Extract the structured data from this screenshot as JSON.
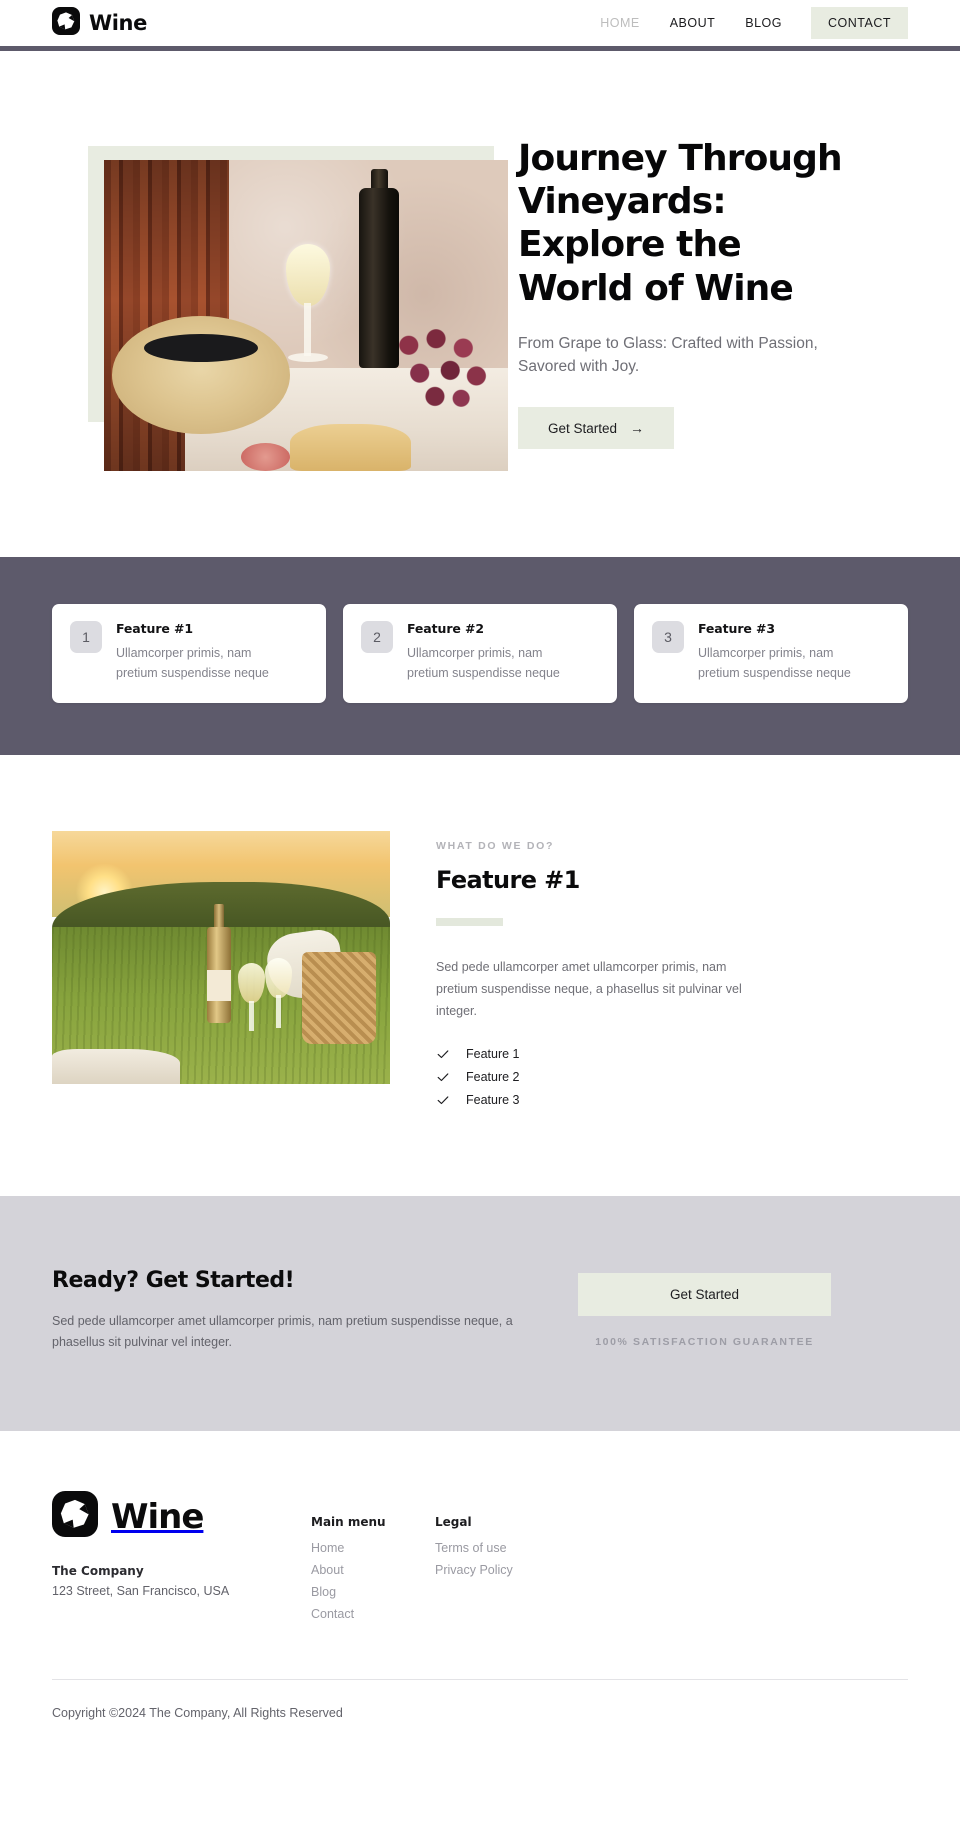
{
  "header": {
    "brand": {
      "name": "Wine",
      "logo_icon": "wine-logo-icon"
    },
    "nav": [
      {
        "label": "HOME",
        "state": "muted"
      },
      {
        "label": "ABOUT",
        "state": "default"
      },
      {
        "label": "BLOG",
        "state": "default"
      }
    ],
    "cta": {
      "label": "CONTACT"
    },
    "accent_color": "#5d5a6b"
  },
  "hero": {
    "image_alt": "wine-bottle-glass-hat-grapes-photo",
    "title": "Journey Through Vineyards: Explore the World of Wine",
    "subtitle": "From Grape to Glass: Crafted with Passion, Savored with Joy.",
    "button": {
      "label": "Get Started",
      "arrow": "→"
    },
    "accent_color": "#e8ece1"
  },
  "feature_strip": {
    "background_color": "#5d5a6b",
    "cards": [
      {
        "number": "1",
        "title": "Feature #1",
        "desc": "Ullamcorper primis, nam pretium suspendisse neque"
      },
      {
        "number": "2",
        "title": "Feature #2",
        "desc": "Ullamcorper primis, nam pretium suspendisse neque"
      },
      {
        "number": "3",
        "title": "Feature #3",
        "desc": "Ullamcorper primis, nam pretium suspendisse neque"
      }
    ]
  },
  "split": {
    "image_alt": "sunset-vineyard-picnic-photo",
    "eyebrow": "WHAT DO WE DO?",
    "title": "Feature #1",
    "desc": "Sed pede ullamcorper amet ullamcorper primis, nam pretium suspendisse neque, a phasellus sit pulvinar vel integer.",
    "checklist": [
      {
        "label": "Feature 1",
        "icon": "check-icon"
      },
      {
        "label": "Feature 2",
        "icon": "check-icon"
      },
      {
        "label": "Feature 3",
        "icon": "check-icon"
      }
    ]
  },
  "cta": {
    "background_color": "#d4d3d9",
    "title": "Ready? Get Started!",
    "desc": "Sed pede ullamcorper amet ullamcorper primis, nam pretium suspendisse neque, a phasellus sit pulvinar vel integer.",
    "button": {
      "label": "Get Started"
    },
    "guarantee": "100% SATISFACTION GUARANTEE"
  },
  "footer": {
    "brand": {
      "name": "Wine",
      "logo_icon": "wine-logo-icon"
    },
    "company": "The Company",
    "address": "123 Street, San Francisco, USA",
    "columns": [
      {
        "title": "Main menu",
        "links": [
          {
            "label": "Home"
          },
          {
            "label": "About"
          },
          {
            "label": "Blog"
          },
          {
            "label": "Contact"
          }
        ]
      },
      {
        "title": "Legal",
        "links": [
          {
            "label": "Terms of use"
          },
          {
            "label": "Privacy Policy"
          }
        ]
      }
    ],
    "copyright": "Copyright ©2024 The Company, All Rights Reserved"
  }
}
